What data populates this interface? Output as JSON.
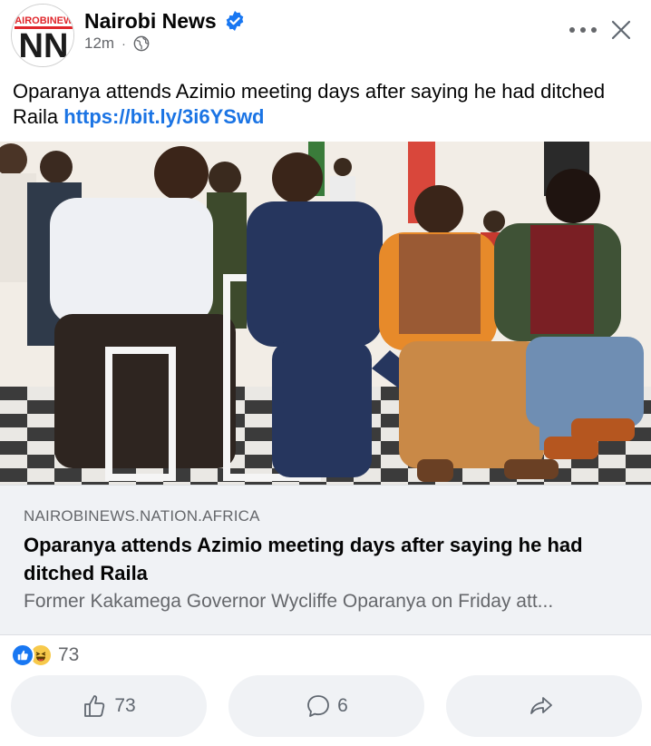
{
  "header": {
    "page_name": "Nairobi News",
    "logo_text": "NAIROBINEWS",
    "logo_letters": "NN",
    "time": "12m",
    "separator": "·",
    "verified_icon": "verified-badge-icon",
    "privacy_icon": "globe-icon"
  },
  "post": {
    "text": "Oparanya attends Azimio meeting days after saying he had ditched Raila ",
    "link": "https://bit.ly/3i6YSwd"
  },
  "preview": {
    "domain": "NAIROBINEWS.NATION.AFRICA",
    "title": "Oparanya attends Azimio meeting days after saying he had ditched Raila",
    "description": "Former Kakamega Governor Wycliffe Oparanya on Friday att..."
  },
  "reactions": {
    "types": [
      "like",
      "haha"
    ],
    "count": "73"
  },
  "actions": {
    "like_count": "73",
    "comment_count": "6",
    "share_label": ""
  },
  "colors": {
    "link": "#1b74e4",
    "like_blue": "#1877f2",
    "secondary_text": "#65676b",
    "button_bg": "#f0f2f5",
    "logo_red": "#e0262b"
  }
}
